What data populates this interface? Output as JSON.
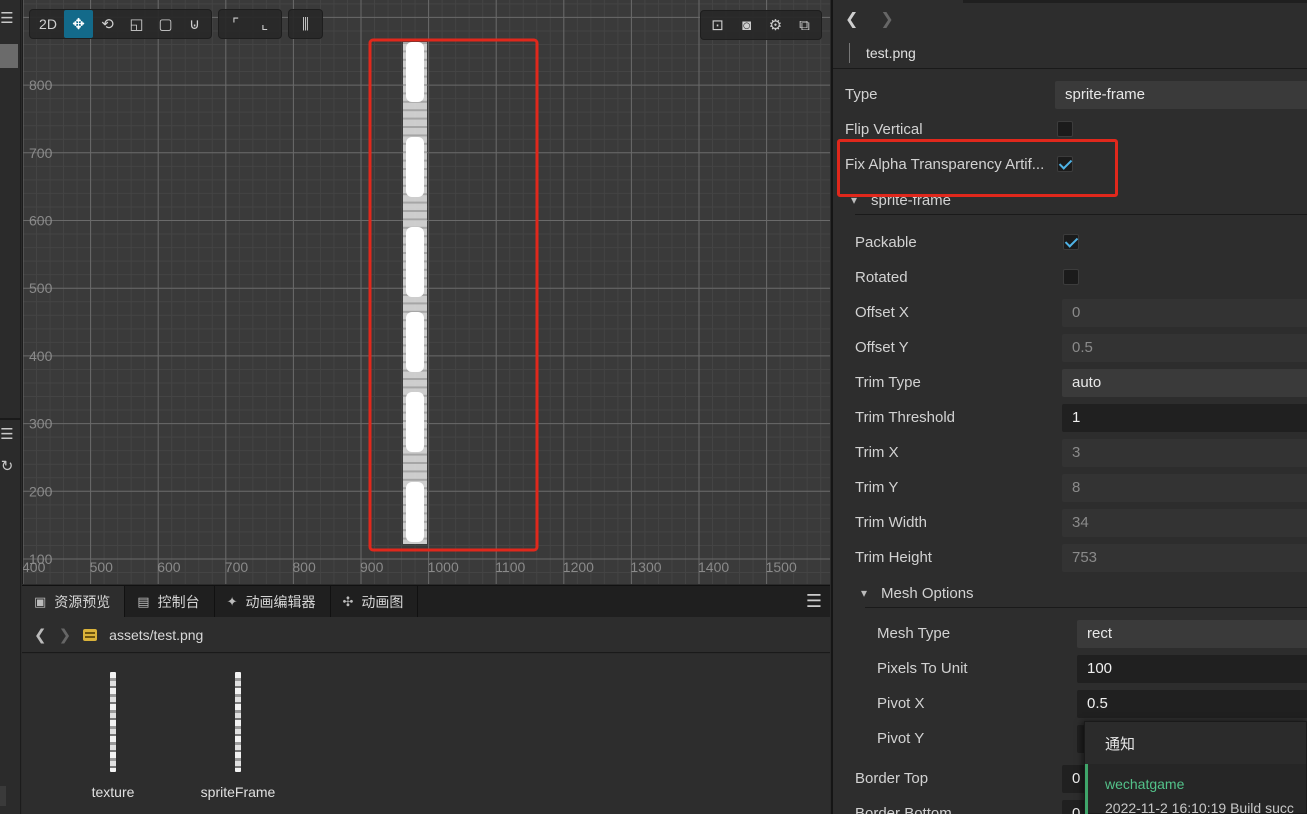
{
  "scene": {
    "mode_label": "2D",
    "tools": [
      "move-icon",
      "rotate-icon",
      "scale-icon",
      "rect-icon",
      "snap-icon",
      "anchor-icon",
      "local-icon",
      "align-icon"
    ],
    "right_tools": [
      "view-icon",
      "camera-icon",
      "gear-icon",
      "gizmo-icon"
    ],
    "x_ticks": [
      "400",
      "500",
      "600",
      "700",
      "800",
      "900",
      "1000",
      "1100",
      "1200",
      "1300",
      "1400",
      "1500"
    ],
    "y_ticks": [
      "800",
      "700",
      "600",
      "500",
      "400",
      "300",
      "200",
      "100"
    ],
    "highlight_color": "#e0281c"
  },
  "bottom": {
    "tabs": [
      {
        "label": "资源预览",
        "icon": "image-icon"
      },
      {
        "label": "控制台",
        "icon": "terminal-icon"
      },
      {
        "label": "动画编辑器",
        "icon": "animation-icon"
      },
      {
        "label": "动画图",
        "icon": "graph-icon"
      }
    ],
    "path_root": "assets",
    "path_sep": "/",
    "path_file": "test.png",
    "assets": [
      {
        "label": "texture"
      },
      {
        "label": "spriteFrame"
      }
    ]
  },
  "inspector": {
    "file_name": "test.png",
    "type_label": "Type",
    "type_value": "sprite-frame",
    "flip_vertical_label": "Flip Vertical",
    "flip_vertical": false,
    "fix_alpha_label": "Fix Alpha Transparency Artif...",
    "fix_alpha": true,
    "section_sprite_frame": "sprite-frame",
    "packable_label": "Packable",
    "packable": true,
    "rotated_label": "Rotated",
    "rotated": false,
    "offset_x_label": "Offset X",
    "offset_x": "0",
    "offset_y_label": "Offset Y",
    "offset_y": "0.5",
    "trim_type_label": "Trim Type",
    "trim_type": "auto",
    "trim_threshold_label": "Trim Threshold",
    "trim_threshold": "1",
    "trim_x_label": "Trim X",
    "trim_x": "3",
    "trim_y_label": "Trim Y",
    "trim_y": "8",
    "trim_width_label": "Trim Width",
    "trim_width": "34",
    "trim_height_label": "Trim Height",
    "trim_height": "753",
    "section_mesh": "Mesh Options",
    "mesh_type_label": "Mesh Type",
    "mesh_type": "rect",
    "ppu_label": "Pixels To Unit",
    "ppu": "100",
    "pivot_x_label": "Pivot X",
    "pivot_x": "0.5",
    "pivot_y_label": "Pivot Y",
    "border_top_label": "Border Top",
    "border_top": "0",
    "border_bottom_label": "Border Bottom",
    "border_bottom": "0"
  },
  "notification": {
    "header": "通知",
    "title": "wechatgame",
    "message": "2022-11-2 16:10:19 Build succ"
  }
}
